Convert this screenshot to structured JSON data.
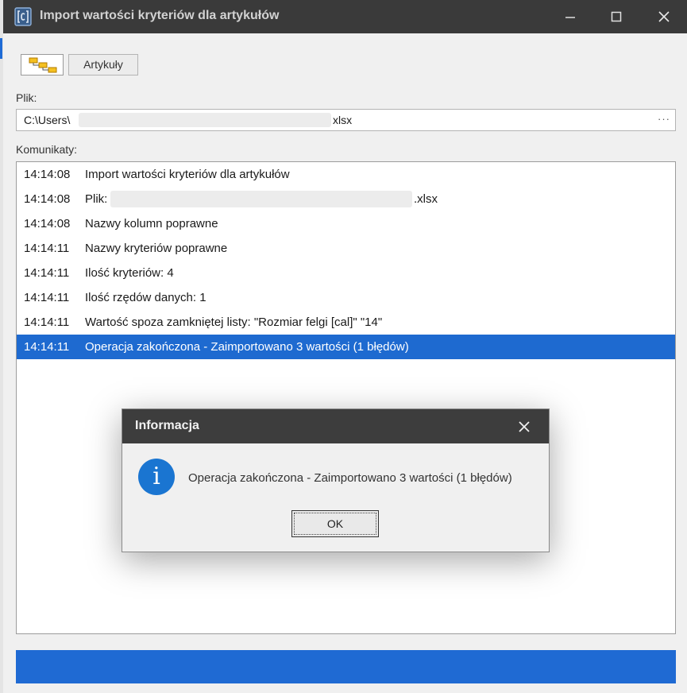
{
  "window": {
    "title": "Import wartości kryteriów dla artykułów",
    "minimize_icon": "minimize-icon",
    "maximize_icon": "maximize-icon",
    "close_icon": "close-icon"
  },
  "toolbar": {
    "tree_icon": "hierarchy-tree-icon",
    "articles_label": "Artykuły"
  },
  "file": {
    "label": "Plik:",
    "value_prefix": "C:\\Users\\",
    "value_suffix": "xlsx",
    "browse_label": "···"
  },
  "messages": {
    "label": "Komunikaty:",
    "rows": [
      {
        "time": "14:14:08",
        "text": "Import wartości kryteriów dla artykułów"
      },
      {
        "time": "14:14:08",
        "text": "Plik:",
        "suffix": ".xlsx"
      },
      {
        "time": "14:14:08",
        "text": "Nazwy kolumn poprawne"
      },
      {
        "time": "14:14:11",
        "text": "Nazwy kryteriów poprawne"
      },
      {
        "time": "14:14:11",
        "text": "Ilość kryteriów: 4"
      },
      {
        "time": "14:14:11",
        "text": "Ilość rzędów danych: 1"
      },
      {
        "time": "14:14:11",
        "text": "Wartość spoza zamkniętej listy: \"Rozmiar felgi [cal]\" \"14\""
      },
      {
        "time": "14:14:11",
        "text": "Operacja zakończona - Zaimportowano 3 wartości (1 błędów)"
      }
    ],
    "selected_index": 7
  },
  "progress": {
    "value_percent": 100
  },
  "dialog": {
    "title": "Informacja",
    "icon": "info-icon",
    "icon_glyph": "i",
    "message": "Operacja zakończona - Zaimportowano 3 wartości (1 błędów)",
    "ok_label": "OK"
  },
  "colors": {
    "titlebar": "#3a3a3a",
    "selection": "#1e6ad0",
    "progress": "#1f6ad3",
    "info_icon": "#1a75d1"
  }
}
